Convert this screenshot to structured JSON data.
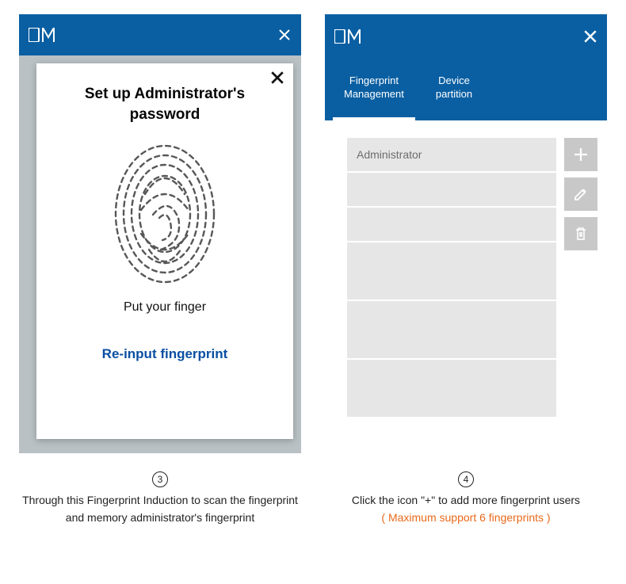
{
  "logo_text": "DM",
  "left": {
    "modal_title": "Set up  Administrator's\npassword",
    "put_finger": "Put your  finger",
    "reinput": "Re-input fingerprint"
  },
  "right": {
    "tabs": [
      {
        "label": "Fingerprint\nManagement",
        "active": true
      },
      {
        "label": "Device\npartition",
        "active": false
      }
    ],
    "rows": [
      {
        "label": "Administrator"
      },
      {
        "label": ""
      },
      {
        "label": ""
      }
    ]
  },
  "captions": {
    "step3_num": "3",
    "step3_text": "Through this  Fingerprint Induction to scan the fingerprint and memory administrator's fingerprint",
    "step4_num": "4",
    "step4_text": "Click  the icon \"+\" to add more fingerprint users",
    "step4_warn": "( Maximum support 6 fingerprints )"
  }
}
